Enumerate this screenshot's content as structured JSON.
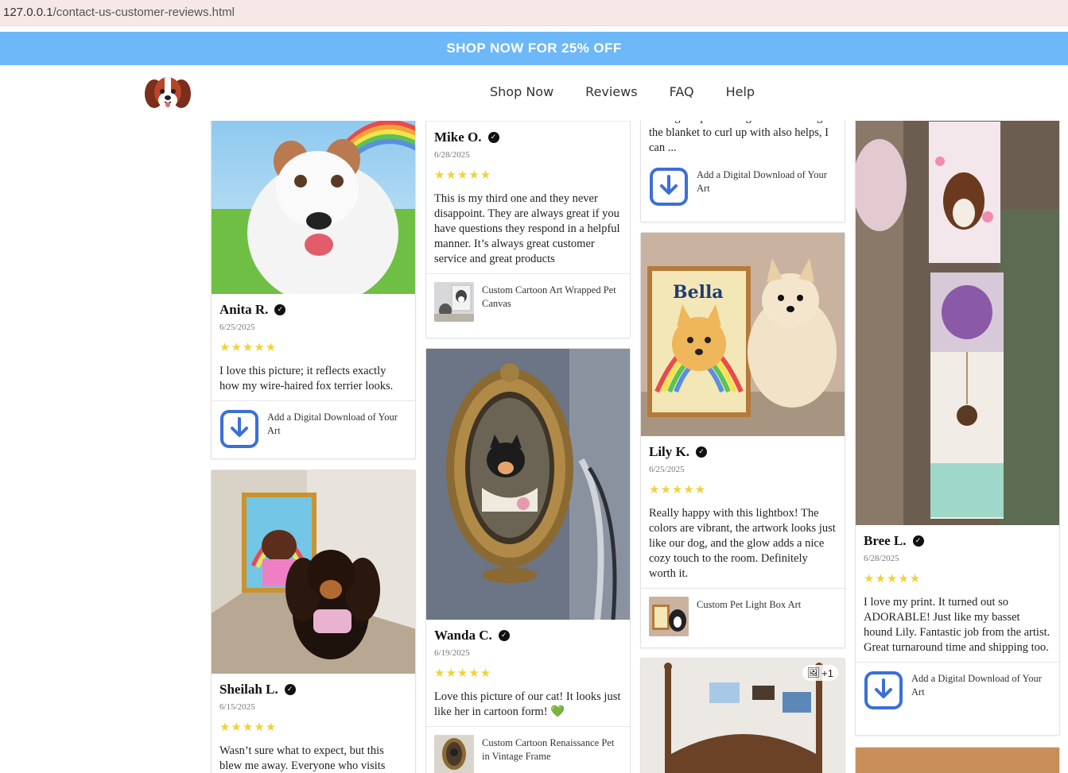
{
  "browser": {
    "url_host": "127.0.0.1",
    "url_path": "/contact-us-customer-reviews.html"
  },
  "promo": {
    "text": "SHOP NOW FOR 25% OFF",
    "color": "#6db8f8"
  },
  "nav": {
    "items": [
      "Shop Now",
      "Reviews",
      "FAQ",
      "Help"
    ]
  },
  "stars": "★★★★★",
  "reviews": {
    "anita": {
      "name": "Anita R.",
      "date": "6/25/2025",
      "rating": 5,
      "text": "I love this picture; it reflects exactly how my wire-haired fox terrier looks.",
      "product": "Add a Digital Download of Your Art",
      "product_icon": "download-icon"
    },
    "sheilah": {
      "name": "Sheilah L.",
      "date": "6/15/2025",
      "rating": 5,
      "text": "Wasn’t sure what to expect, but this blew me away. Everyone who visits"
    },
    "mike": {
      "name": "Mike O.",
      "date": "6/28/2025",
      "rating": 5,
      "text": "This is my third one and they never disappoint. They are always great if you have questions they respond in a helpful manner. It’s always great customer service and great products",
      "product": "Custom Cartoon Art Wrapped Pet Canvas"
    },
    "wanda": {
      "name": "Wanda C.",
      "date": "6/19/2025",
      "rating": 5,
      "text": "Love this picture of our cat! It looks just like her in cartoon form!",
      "emoji": "💚",
      "product": "Custom Cartoon Renaissance Pet in Vintage Frame"
    },
    "top3": {
      "text": "having the picture is great and having the blanket to curl up with also helps, I can ...",
      "product": "Add a Digital Download of Your Art"
    },
    "lily": {
      "name": "Lily K.",
      "date": "6/25/2025",
      "rating": 5,
      "text": "Really happy with this lightbox! The colors are vibrant, the artwork looks just like our dog, and the glow adds a nice cozy touch to the room. Definitely worth it.",
      "product": "Custom Pet Light Box Art",
      "image_label": "Bella"
    },
    "bree": {
      "name": "Bree L.",
      "date": "6/28/2025",
      "rating": 5,
      "text": "I love my print. It turned out so ADORABLE! Just like my basset hound Lily. Fantastic job from the artist. Great turnaround time and shipping too.",
      "product": "Add a Digital Download of Your Art"
    },
    "bed": {
      "more_images": "+1"
    }
  },
  "colors": {
    "star": "#f0d23a",
    "download_icon": "#3b6fd8"
  }
}
